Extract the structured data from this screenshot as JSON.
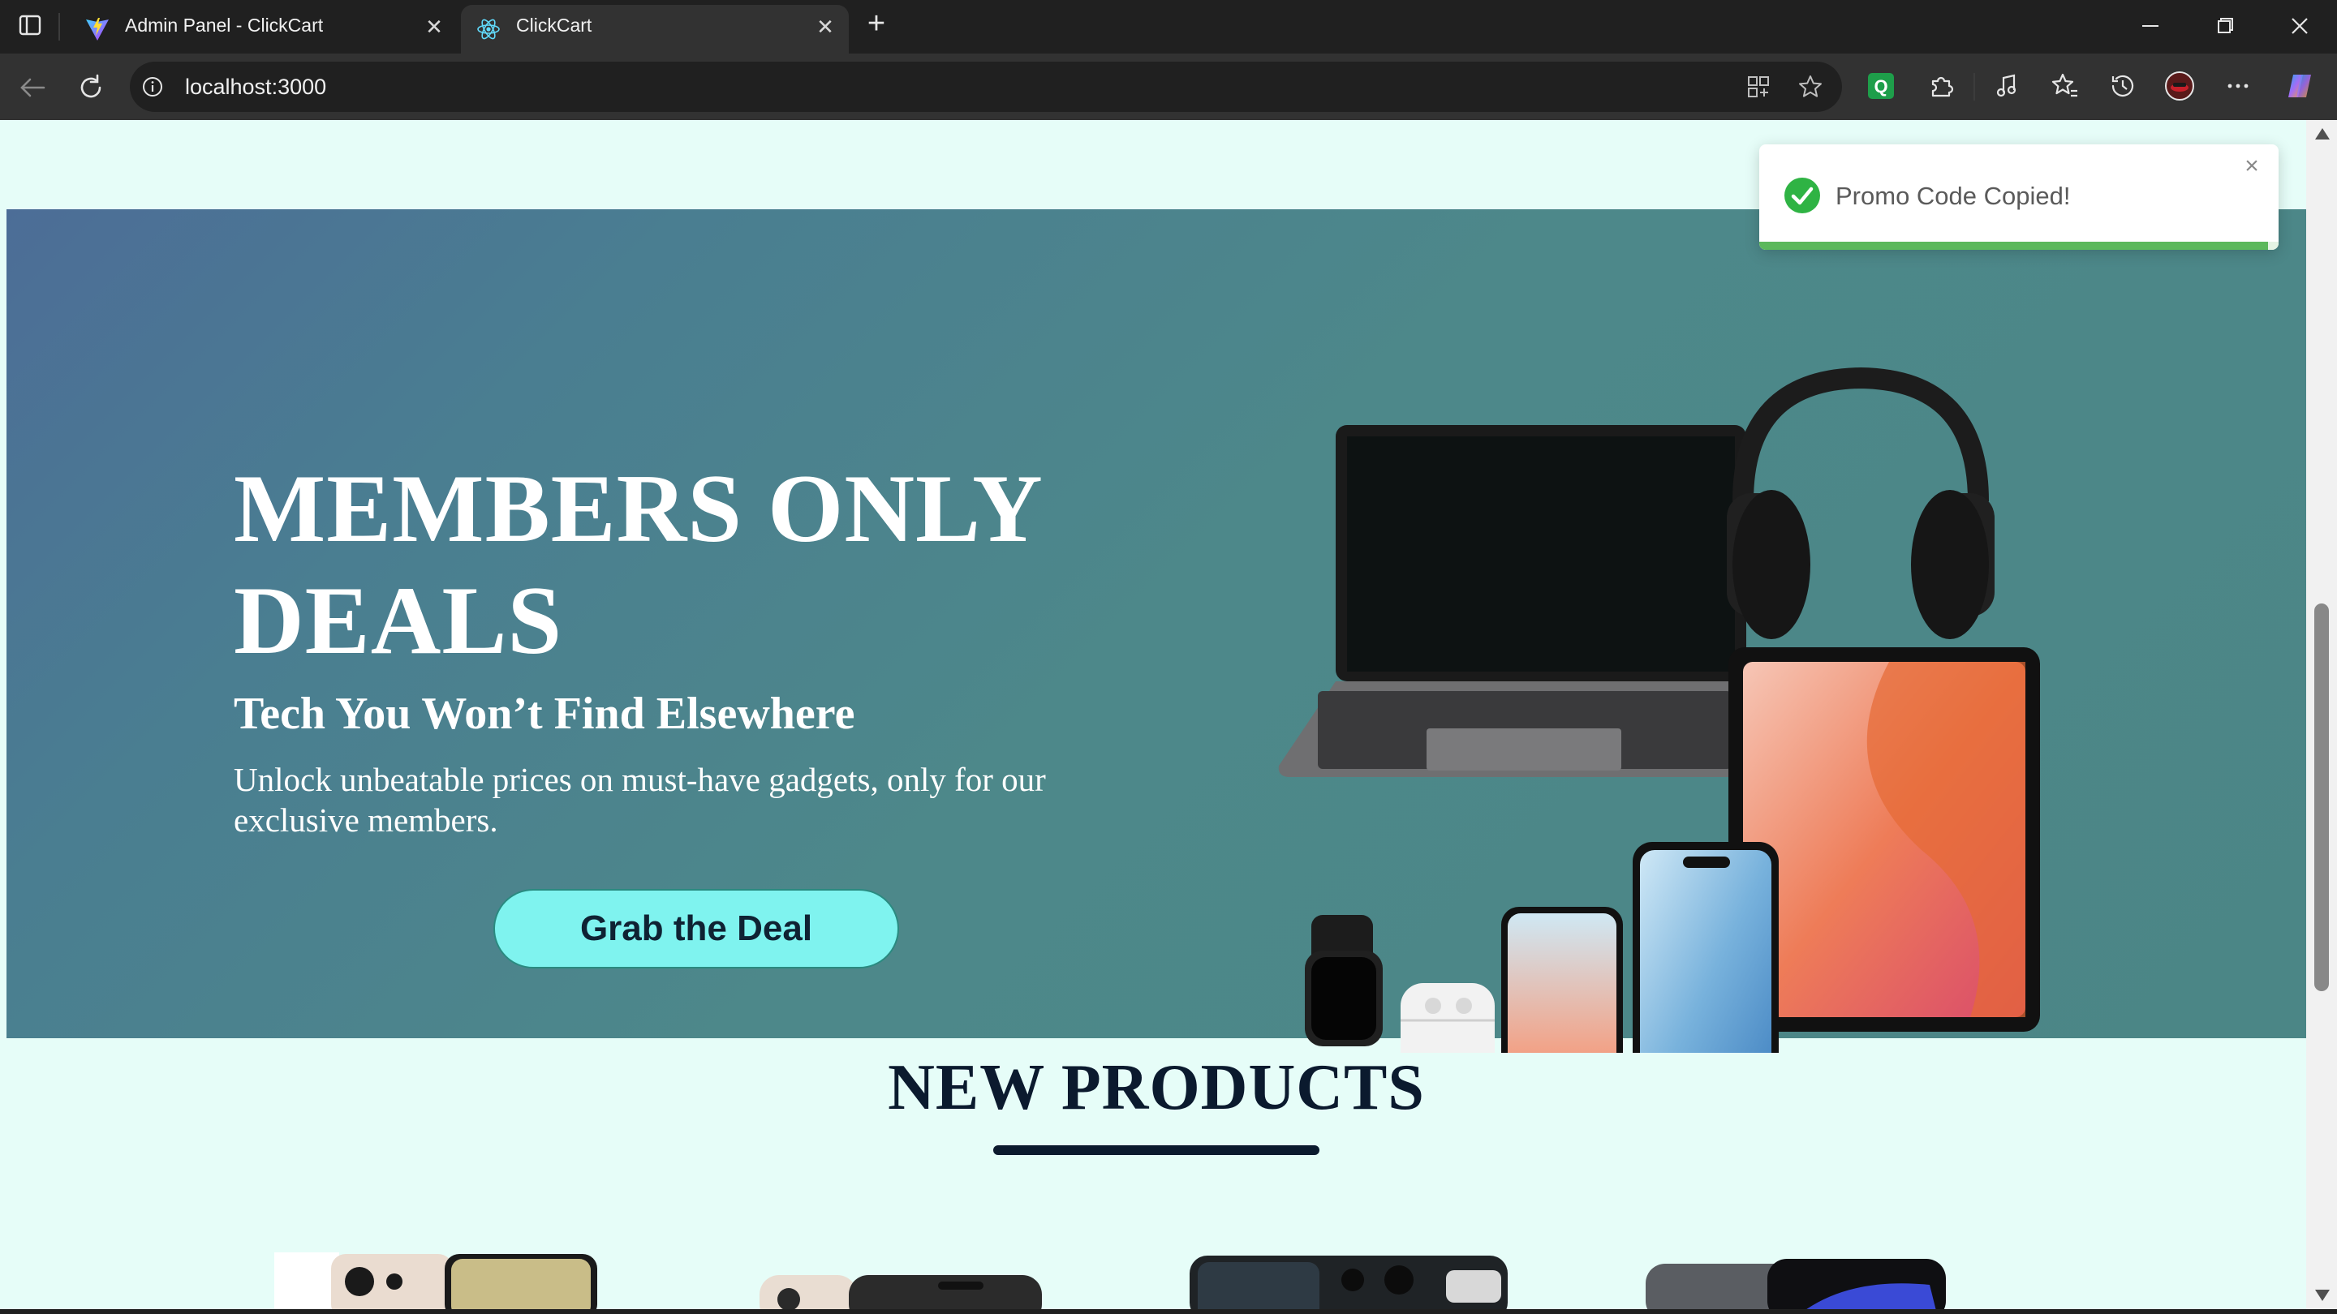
{
  "browser": {
    "tabs": [
      {
        "title": "Admin Panel - ClickCart",
        "active": false
      },
      {
        "title": "ClickCart",
        "active": true
      }
    ],
    "url": "localhost:3000"
  },
  "hero": {
    "title": "MEMBERS ONLY DEALS",
    "subtitle": "Tech You Won’t Find Elsewhere",
    "description": "Unlock unbeatable prices on must-have gadgets, only for our exclusive members.",
    "cta_label": "Grab the Deal"
  },
  "new_products": {
    "title": "NEW PRODUCTS"
  },
  "toast": {
    "message": "Promo Code Copied!",
    "progress": 0.98
  },
  "colors": {
    "accent_cyan": "#7ff3ef",
    "page_bg": "#e6fdf8",
    "heading_navy": "#0b1a2e",
    "success_green": "#5cb85c"
  }
}
